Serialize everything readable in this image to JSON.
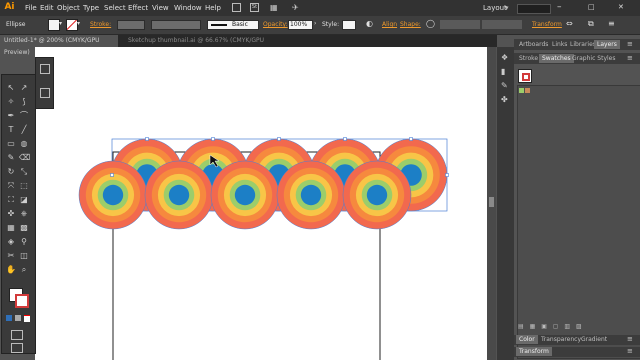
{
  "app": {
    "logo": "Ai",
    "menus": [
      "File",
      "Edit",
      "Object",
      "Type",
      "Select",
      "Effect",
      "View",
      "Window",
      "Help"
    ],
    "workspace": "Layout"
  },
  "control": {
    "selection": "Ellipse",
    "stroke_label": "Stroke:",
    "brush": "Basic",
    "opacity_label": "Opacity:",
    "opacity": "100%",
    "style_label": "Style:",
    "align_label": "Align",
    "shape_label": "Shape:",
    "transform_label": "Transform"
  },
  "docs": [
    {
      "title": "Untitled-1* @ 200% (CMYK/GPU Preview)",
      "close": "×"
    },
    {
      "title": "Sketchup thumbnail.ai @ 66.67% (CMYK/GPU Preview)",
      "close": "×"
    }
  ],
  "panel": {
    "top_tabs": [
      "Artboards",
      "Links",
      "Libraries",
      "Layers"
    ],
    "tabs": [
      "Stroke",
      "Swatches",
      "Graphic Styles"
    ],
    "bottom_tabs": [
      [
        "Color",
        "Transparency",
        "Gradient"
      ],
      [
        "Transform"
      ]
    ]
  },
  "colors": {
    "ring_outer": "#f2694e",
    "ring_2": "#f6893e",
    "ring_3": "#f8c547",
    "ring_4": "#9ccd6a",
    "center": "#1c7fc6"
  }
}
